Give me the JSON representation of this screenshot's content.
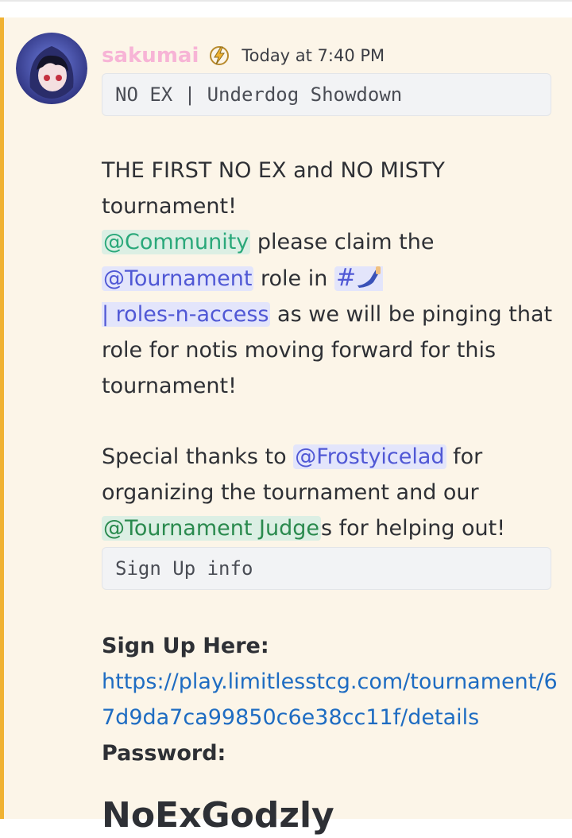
{
  "message": {
    "username": "sakumai",
    "timestamp": "Today at 7:40 PM",
    "code_title": "NO EX | Underdog Showdown",
    "para1": {
      "line1": "THE FIRST NO EX and NO MISTY tournament!",
      "mention_community": "@Community",
      "text_claim": " please claim the ",
      "mention_tournament": "@Tournament",
      "text_role_in": " role in ",
      "channel_hash": "#",
      "channel_name": "| roles-n-access",
      "text_rest": " as we will be pinging that role for notis moving forward for this tournament!"
    },
    "para2": {
      "text_thanks": "Special thanks to ",
      "mention_frosty": "@Frostyicelad",
      "text_for": " for organizing the tournament and our ",
      "mention_judges": "@Tournament Judge",
      "text_end": "s for helping out!"
    },
    "code_signup": "Sign Up info",
    "signup": {
      "label": "Sign Up Here:",
      "url": "https://play.limitlesstcg.com/tournament/67d9da7ca99850c6e38cc11f/details",
      "password_label": "Password:",
      "password_value": "NoExGodzly"
    }
  },
  "colors": {
    "highlight": "#f0b232",
    "background": "#fcf5e8",
    "username": "#f7b4d6",
    "link": "#1e6cc2",
    "mention_blue": "#5058d5",
    "mention_green": "#2a8a4e"
  },
  "icons": [
    "avatar",
    "lightning-badge-icon",
    "arm-emoji-icon"
  ]
}
